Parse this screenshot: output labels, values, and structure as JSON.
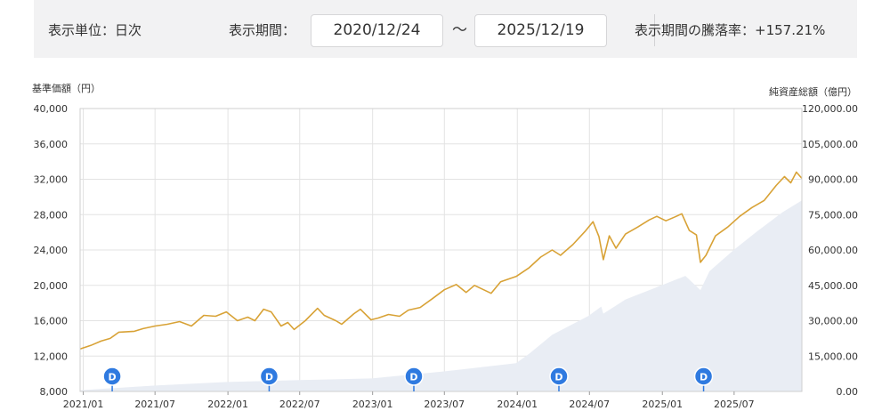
{
  "header": {
    "unit_label": "表示単位：日次",
    "period_label": "表示期間：",
    "start_date": "2020/12/24",
    "separator": "～",
    "end_date": "2025/12/19",
    "change_label": "表示期間の騰落率：",
    "change_value": "+157.21%"
  },
  "colors": {
    "price_line": "#d8a236",
    "aum_fill": "#e9edf4",
    "grid": "#e3e3e3",
    "marker": "#2f7ae0"
  },
  "chart_data": {
    "type": "line",
    "title": "",
    "y_left_label": "基準価額（円）",
    "y_right_label": "純資産総額（億円）",
    "y_left_range": [
      8000,
      40000
    ],
    "y_left_ticks": [
      "8,000",
      "12,000",
      "16,000",
      "20,000",
      "24,000",
      "28,000",
      "32,000",
      "36,000",
      "40,000"
    ],
    "y_right_range": [
      0,
      120000
    ],
    "y_right_ticks": [
      "0.00",
      "15,000.00",
      "30,000.00",
      "45,000.00",
      "60,000.00",
      "75,000.00",
      "90,000.00",
      "105,000.00",
      "120,000.00"
    ],
    "x_range": [
      "2020-12-24",
      "2025-12-19"
    ],
    "x_ticks": [
      {
        "date": "2021-01-01",
        "label": "2021/01"
      },
      {
        "date": "2021-07-01",
        "label": "2021/07"
      },
      {
        "date": "2022-01-01",
        "label": "2022/01"
      },
      {
        "date": "2022-07-01",
        "label": "2022/07"
      },
      {
        "date": "2023-01-01",
        "label": "2023/01"
      },
      {
        "date": "2023-07-01",
        "label": "2023/07"
      },
      {
        "date": "2024-01-01",
        "label": "2024/01"
      },
      {
        "date": "2024-07-01",
        "label": "2024/07"
      },
      {
        "date": "2025-01-01",
        "label": "2025/01"
      },
      {
        "date": "2025-07-01",
        "label": "2025/07"
      }
    ],
    "grid": true,
    "series": [
      {
        "name": "基準価額",
        "axis": "left",
        "points": [
          [
            "2020-12-24",
            12800
          ],
          [
            "2021-01-20",
            13200
          ],
          [
            "2021-02-15",
            13700
          ],
          [
            "2021-03-10",
            14000
          ],
          [
            "2021-04-01",
            14700
          ],
          [
            "2021-05-10",
            14800
          ],
          [
            "2021-06-01",
            15100
          ],
          [
            "2021-07-01",
            15400
          ],
          [
            "2021-08-01",
            15600
          ],
          [
            "2021-09-01",
            15900
          ],
          [
            "2021-10-01",
            15400
          ],
          [
            "2021-11-01",
            16600
          ],
          [
            "2021-12-01",
            16500
          ],
          [
            "2021-12-28",
            17000
          ],
          [
            "2022-01-25",
            16000
          ],
          [
            "2022-02-20",
            16400
          ],
          [
            "2022-03-10",
            16000
          ],
          [
            "2022-04-01",
            17300
          ],
          [
            "2022-04-20",
            17000
          ],
          [
            "2022-05-15",
            15400
          ],
          [
            "2022-06-01",
            15800
          ],
          [
            "2022-06-17",
            15000
          ],
          [
            "2022-07-15",
            16000
          ],
          [
            "2022-08-15",
            17400
          ],
          [
            "2022-09-01",
            16600
          ],
          [
            "2022-09-30",
            16000
          ],
          [
            "2022-10-15",
            15600
          ],
          [
            "2022-11-15",
            16800
          ],
          [
            "2022-12-01",
            17300
          ],
          [
            "2022-12-28",
            16100
          ],
          [
            "2023-01-15",
            16300
          ],
          [
            "2023-02-10",
            16700
          ],
          [
            "2023-03-10",
            16500
          ],
          [
            "2023-04-01",
            17200
          ],
          [
            "2023-05-01",
            17500
          ],
          [
            "2023-06-01",
            18500
          ],
          [
            "2023-07-01",
            19500
          ],
          [
            "2023-07-31",
            20100
          ],
          [
            "2023-08-25",
            19200
          ],
          [
            "2023-09-15",
            20000
          ],
          [
            "2023-10-27",
            19100
          ],
          [
            "2023-11-20",
            20400
          ],
          [
            "2023-12-29",
            21000
          ],
          [
            "2024-01-31",
            22000
          ],
          [
            "2024-02-29",
            23200
          ],
          [
            "2024-03-29",
            24000
          ],
          [
            "2024-04-19",
            23400
          ],
          [
            "2024-05-20",
            24600
          ],
          [
            "2024-06-20",
            26100
          ],
          [
            "2024-07-10",
            27200
          ],
          [
            "2024-07-25",
            25500
          ],
          [
            "2024-08-05",
            22900
          ],
          [
            "2024-08-20",
            25600
          ],
          [
            "2024-09-06",
            24200
          ],
          [
            "2024-09-30",
            25800
          ],
          [
            "2024-10-31",
            26600
          ],
          [
            "2024-11-29",
            27400
          ],
          [
            "2024-12-18",
            27800
          ],
          [
            "2025-01-10",
            27300
          ],
          [
            "2025-01-31",
            27700
          ],
          [
            "2025-02-19",
            28100
          ],
          [
            "2025-03-10",
            26200
          ],
          [
            "2025-03-28",
            25700
          ],
          [
            "2025-04-07",
            22600
          ],
          [
            "2025-04-21",
            23400
          ],
          [
            "2025-05-15",
            25600
          ],
          [
            "2025-06-15",
            26600
          ],
          [
            "2025-07-15",
            27800
          ],
          [
            "2025-08-15",
            28800
          ],
          [
            "2025-09-15",
            29600
          ],
          [
            "2025-10-15",
            31300
          ],
          [
            "2025-11-05",
            32300
          ],
          [
            "2025-11-21",
            31600
          ],
          [
            "2025-12-05",
            32800
          ],
          [
            "2025-12-19",
            32100
          ]
        ]
      },
      {
        "name": "純資産総額",
        "axis": "right",
        "type": "area",
        "points": [
          [
            "2020-12-24",
            500
          ],
          [
            "2021-03-01",
            1200
          ],
          [
            "2021-07-01",
            2500
          ],
          [
            "2021-12-31",
            4000
          ],
          [
            "2022-06-30",
            4800
          ],
          [
            "2022-12-30",
            5500
          ],
          [
            "2023-06-30",
            8500
          ],
          [
            "2023-12-29",
            12000
          ],
          [
            "2024-01-31",
            16000
          ],
          [
            "2024-03-29",
            24000
          ],
          [
            "2024-06-28",
            32000
          ],
          [
            "2024-07-31",
            36000
          ],
          [
            "2024-08-05",
            33000
          ],
          [
            "2024-09-30",
            39000
          ],
          [
            "2024-12-30",
            45000
          ],
          [
            "2025-02-28",
            49000
          ],
          [
            "2025-04-07",
            43000
          ],
          [
            "2025-04-30",
            51000
          ],
          [
            "2025-06-30",
            60000
          ],
          [
            "2025-08-29",
            68000
          ],
          [
            "2025-10-31",
            76000
          ],
          [
            "2025-12-19",
            81000
          ]
        ]
      }
    ],
    "markers": [
      {
        "date": "2021-03-15",
        "label": "D"
      },
      {
        "date": "2022-04-15",
        "label": "D"
      },
      {
        "date": "2023-04-15",
        "label": "D"
      },
      {
        "date": "2024-04-15",
        "label": "D"
      },
      {
        "date": "2025-04-15",
        "label": "D"
      }
    ]
  }
}
